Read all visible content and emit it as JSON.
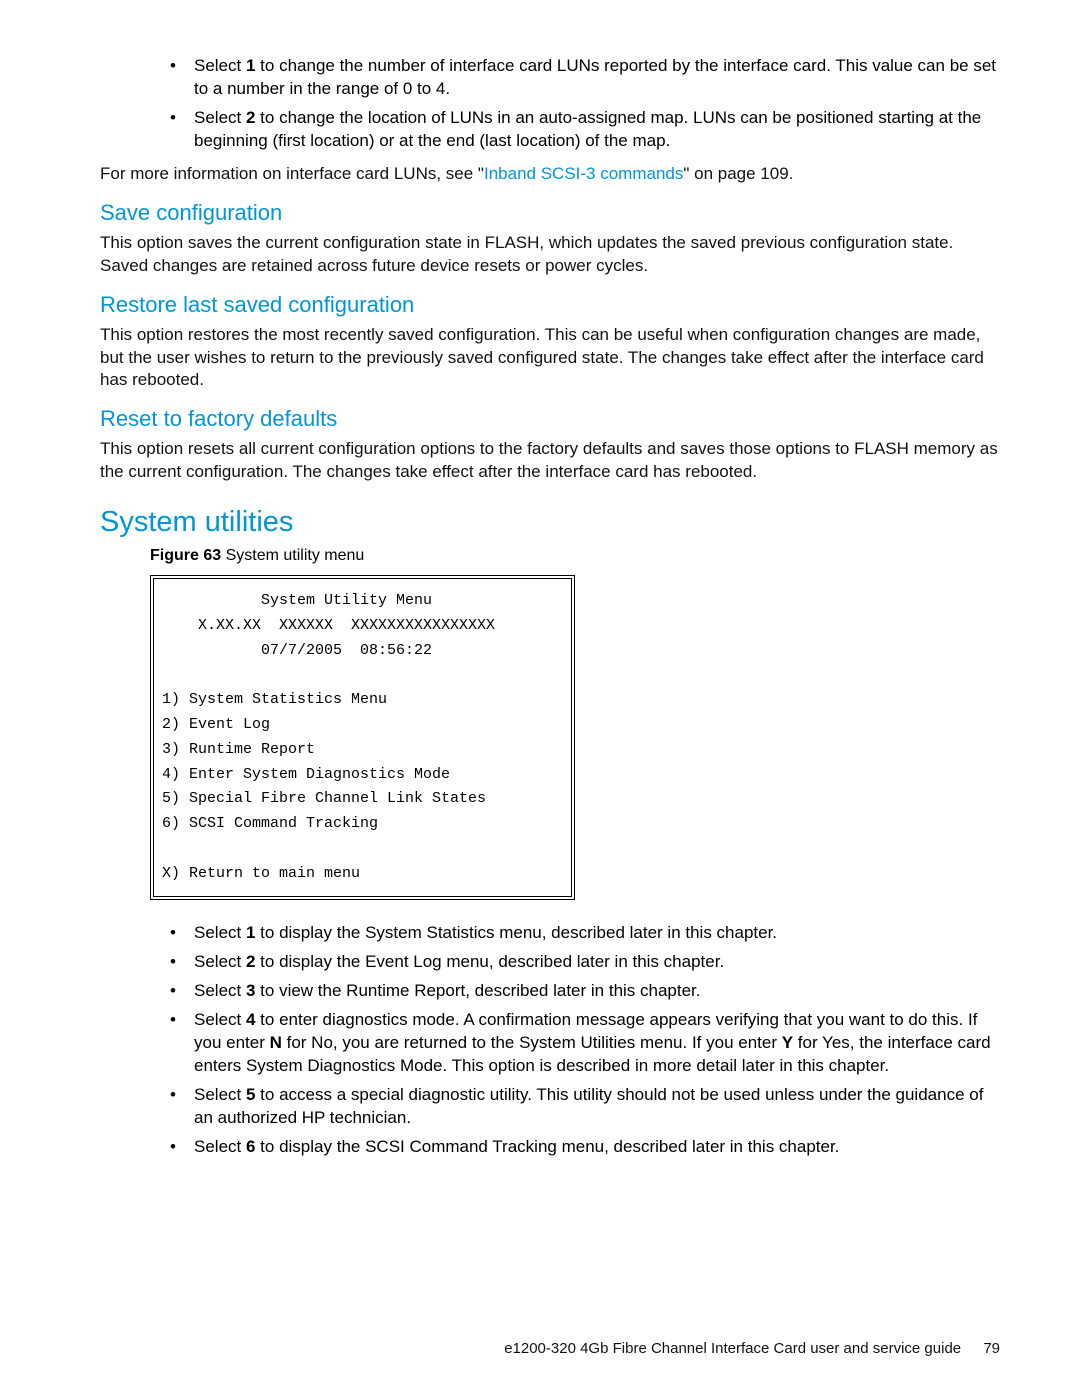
{
  "topBullets": [
    {
      "pre": "Select ",
      "bold": "1",
      "post": " to change the number of interface card LUNs reported by the interface card. This value can be set to a number in the range of 0 to 4."
    },
    {
      "pre": "Select ",
      "bold": "2",
      "post": " to change the location of LUNs in an auto-assigned map. LUNs can be positioned starting at the beginning (first location) or at the end (last location) of the map."
    }
  ],
  "moreInfo": {
    "pre": "For more information on interface card LUNs, see \"",
    "link": "Inband SCSI-3 commands",
    "post": "\" on page 109."
  },
  "saveConfig": {
    "heading": "Save configuration",
    "text": "This option saves the current configuration state in FLASH, which updates the saved previous configuration state. Saved changes are retained across future device resets or power cycles."
  },
  "restore": {
    "heading": "Restore last saved configuration",
    "text": "This option restores the most recently saved configuration. This can be useful when configuration changes are made, but the user wishes to return to the previously saved configured state. The changes take effect after the interface card has rebooted."
  },
  "reset": {
    "heading": "Reset to factory defaults",
    "text": "This option resets all current configuration options to the factory defaults and saves those options to FLASH memory as the current configuration. The changes take effect after the interface card has rebooted."
  },
  "systemUtilities": {
    "heading": "System utilities",
    "figureLabel": "Figure 63",
    "figureCaption": " System utility menu"
  },
  "menu": {
    "title": "System Utility Menu",
    "version": "X.XX.XX  XXXXXX  XXXXXXXXXXXXXXXX",
    "timestamp": "07/7/2005  08:56:22",
    "items": [
      "1) System Statistics Menu",
      "2) Event Log",
      "3) Runtime Report",
      "4) Enter System Diagnostics Mode",
      "5) Special Fibre Channel Link States",
      "6) SCSI Command Tracking"
    ],
    "return": "X) Return to main menu"
  },
  "bottomBullets": [
    {
      "pre": "Select ",
      "bold": "1",
      "post": " to display the System Statistics menu, described later in this chapter."
    },
    {
      "pre": "Select ",
      "bold": "2",
      "post": " to display the Event Log menu, described later in this chapter."
    },
    {
      "pre": "Select ",
      "bold": "3",
      "post": " to view the Runtime Report, described later in this chapter."
    },
    {
      "pre": "Select ",
      "bold": "4",
      "post": " to enter diagnostics mode. A confirmation message appears verifying that you want to do this. If you enter ",
      "bold2": "N",
      "post2": " for No, you are returned to the System Utilities menu. If you enter ",
      "bold3": "Y",
      "post3": " for Yes, the interface card enters System Diagnostics Mode. This option is described in more detail later in this chapter."
    },
    {
      "pre": "Select ",
      "bold": "5",
      "post": " to access a special diagnostic utility. This utility should not be used unless under the guidance of an authorized HP technician."
    },
    {
      "pre": "Select ",
      "bold": "6",
      "post": " to display the SCSI Command Tracking menu, described later in this chapter."
    }
  ],
  "footer": {
    "text": "e1200-320 4Gb Fibre Channel Interface Card user and service guide",
    "page": "79"
  }
}
